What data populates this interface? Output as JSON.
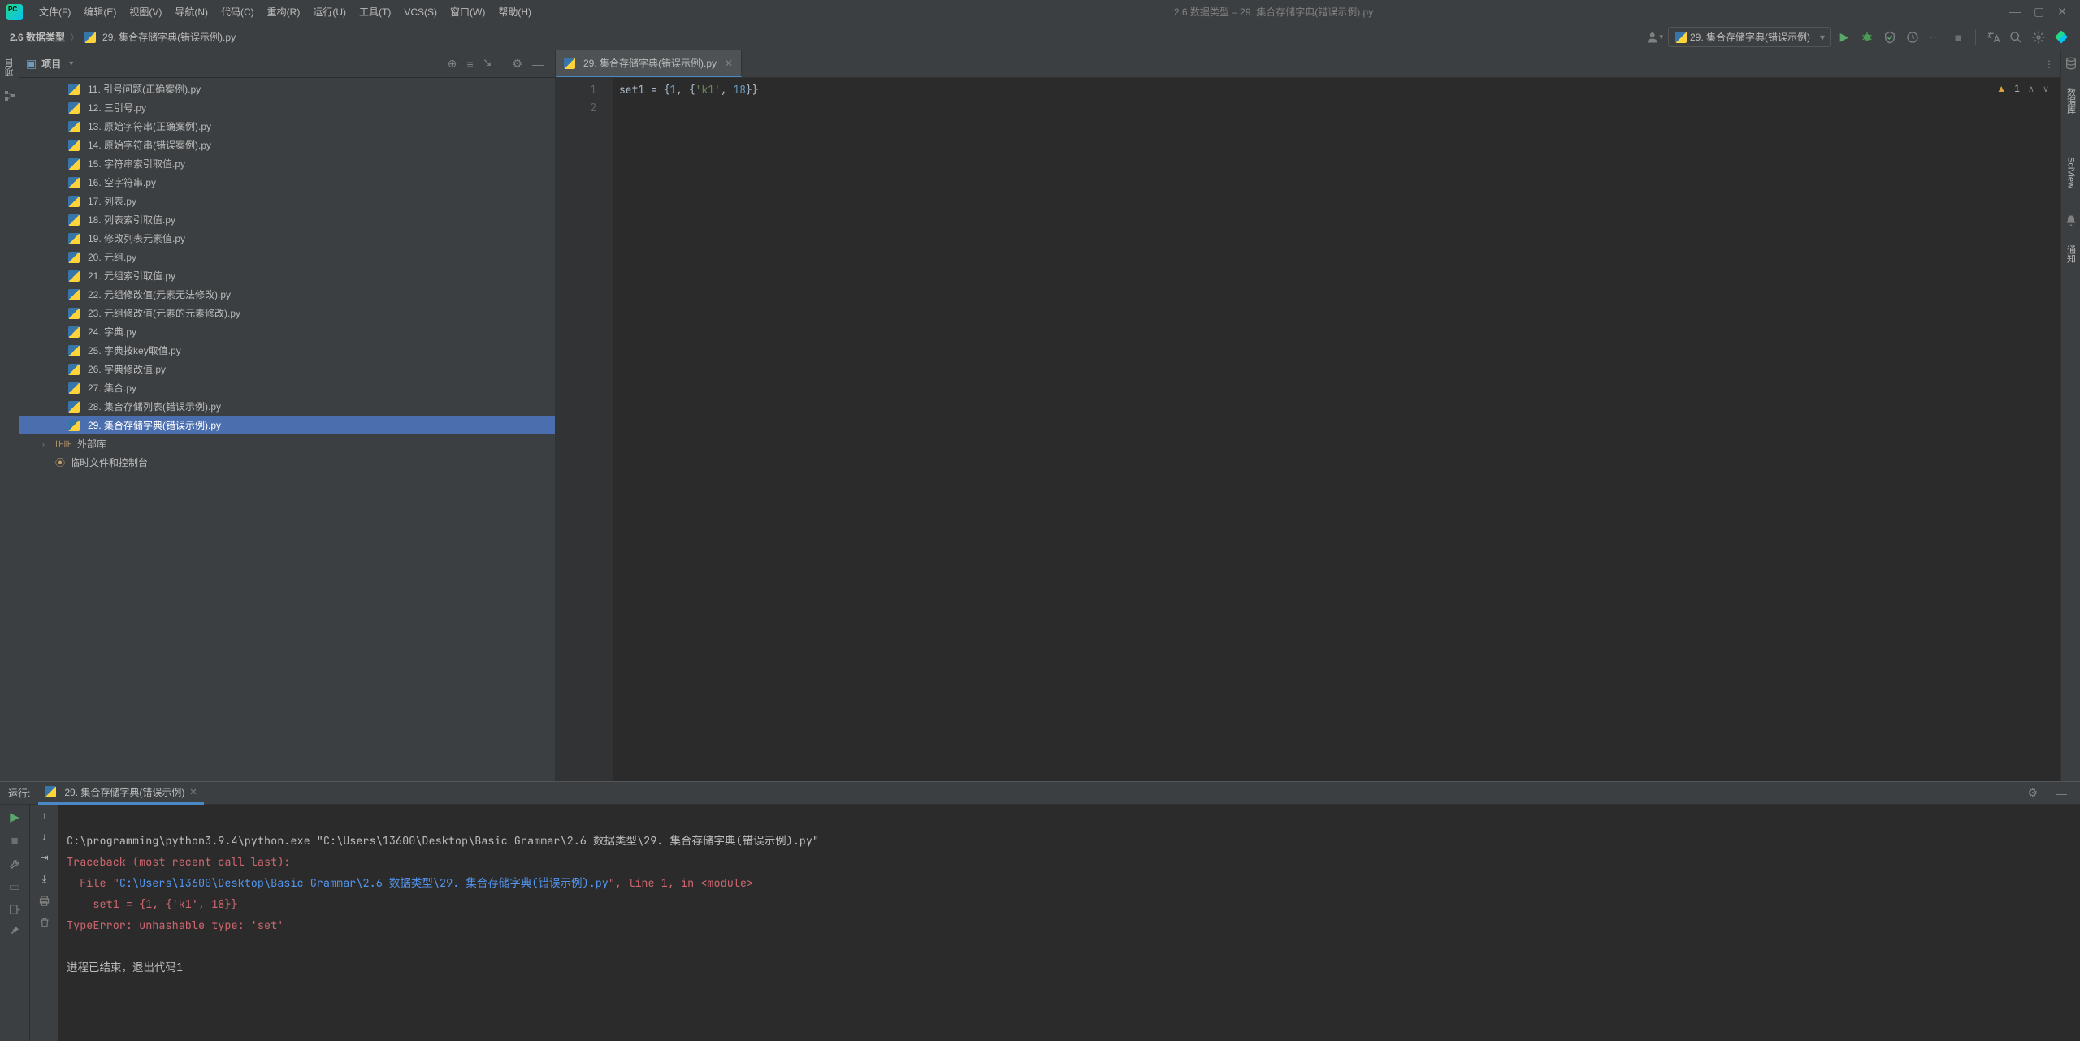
{
  "window": {
    "title": "2.6 数据类型 – 29. 集合存储字典(错误示例).py"
  },
  "menu": [
    "文件(F)",
    "编辑(E)",
    "视图(V)",
    "导航(N)",
    "代码(C)",
    "重构(R)",
    "运行(U)",
    "工具(T)",
    "VCS(S)",
    "窗口(W)",
    "帮助(H)"
  ],
  "breadcrumb": {
    "root": "2.6 数据类型",
    "file": "29. 集合存储字典(错误示例).py"
  },
  "run_config": {
    "selected": "29. 集合存储字典(错误示例)"
  },
  "project": {
    "label": "项目",
    "files": [
      "11. 引号问题(正确案例).py",
      "12. 三引号.py",
      "13. 原始字符串(正确案例).py",
      "14. 原始字符串(错误案例).py",
      "15. 字符串索引取值.py",
      "16. 空字符串.py",
      "17. 列表.py",
      "18. 列表索引取值.py",
      "19. 修改列表元素值.py",
      "20. 元组.py",
      "21. 元组索引取值.py",
      "22. 元组修改值(元素无法修改).py",
      "23. 元组修改值(元素的元素修改).py",
      "24. 字典.py",
      "25. 字典按key取值.py",
      "26. 字典修改值.py",
      "27. 集合.py",
      "28. 集合存储列表(错误示例).py",
      "29. 集合存储字典(错误示例).py"
    ],
    "selected_index": 18,
    "external_lib": "外部库",
    "scratch": "临时文件和控制台"
  },
  "editor": {
    "tab": "29. 集合存储字典(错误示例).py",
    "lines": [
      "1",
      "2"
    ],
    "code": {
      "var": "set1",
      "op": " = ",
      "lbrace1": "{",
      "n1": "1",
      "comma1": ", ",
      "lbrace2": "{",
      "str": "'k1'",
      "comma2": ", ",
      "n2": "18",
      "rbrace2": "}",
      "rbrace1": "}"
    },
    "warning_count": "1"
  },
  "run": {
    "label": "运行:",
    "tab": "29. 集合存储字典(错误示例)",
    "console": {
      "cmd": "C:\\programming\\python3.9.4\\python.exe \"C:\\Users\\13600\\Desktop\\Basic Grammar\\2.6 数据类型\\29. 集合存储字典(错误示例).py\"",
      "tb_header": "Traceback (most recent call last):",
      "file_prefix": "  File \"",
      "file_link": "C:\\Users\\13600\\Desktop\\Basic Grammar\\2.6 数据类型\\29. 集合存储字典(错误示例).py",
      "file_suffix": "\", line 1, in <module>",
      "code_line": "    set1 = {1, {'k1', 18}}",
      "error": "TypeError: unhashable type: 'set'",
      "blank": "",
      "exit": "进程已结束，退出代码1"
    }
  },
  "right_tabs": {
    "db": "数据库",
    "sci": "SciView",
    "notify": "通知"
  },
  "left_tabs": {
    "proj": "项目"
  }
}
